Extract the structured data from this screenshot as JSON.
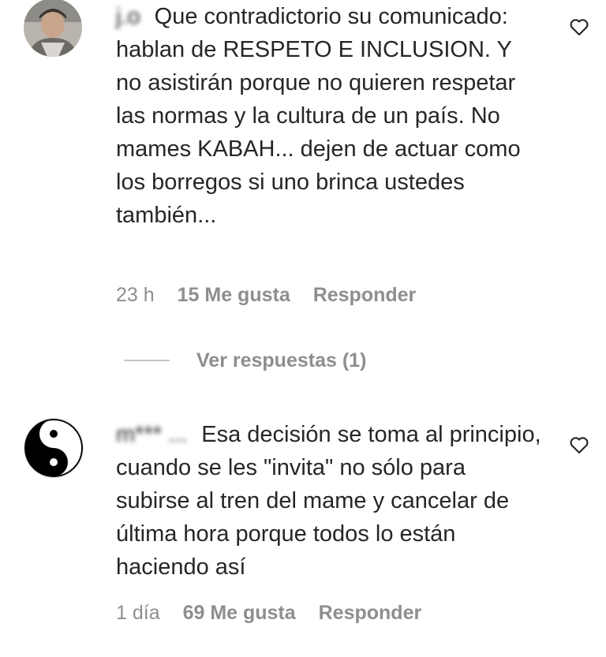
{
  "comments": [
    {
      "username": "j.o",
      "text": "Que contradictorio su comunicado: hablan de RESPETO E INCLUSION. Y no asistirán porque no quieren respetar las normas y la cultura de un país. No mames KABAH... dejen de actuar como los borregos si uno brinca ustedes también...",
      "time": "23 h",
      "likes": "15 Me gusta",
      "reply_label": "Responder",
      "avatar_icon": "person-photo-avatar"
    },
    {
      "username": "m*** ...",
      "text": "Esa decisión se toma al principio, cuando se les \"invita\" no sólo para subirse al tren del mame y cancelar de última hora porque todos lo están haciendo así",
      "time": "1 día",
      "likes": "69 Me gusta",
      "reply_label": "Responder",
      "avatar_icon": "yin-yang-avatar"
    }
  ],
  "view_replies": "Ver respuestas (1)",
  "colors": {
    "text": "#262626",
    "secondary": "#8e8e8e",
    "divider": "#c7c7c7"
  }
}
